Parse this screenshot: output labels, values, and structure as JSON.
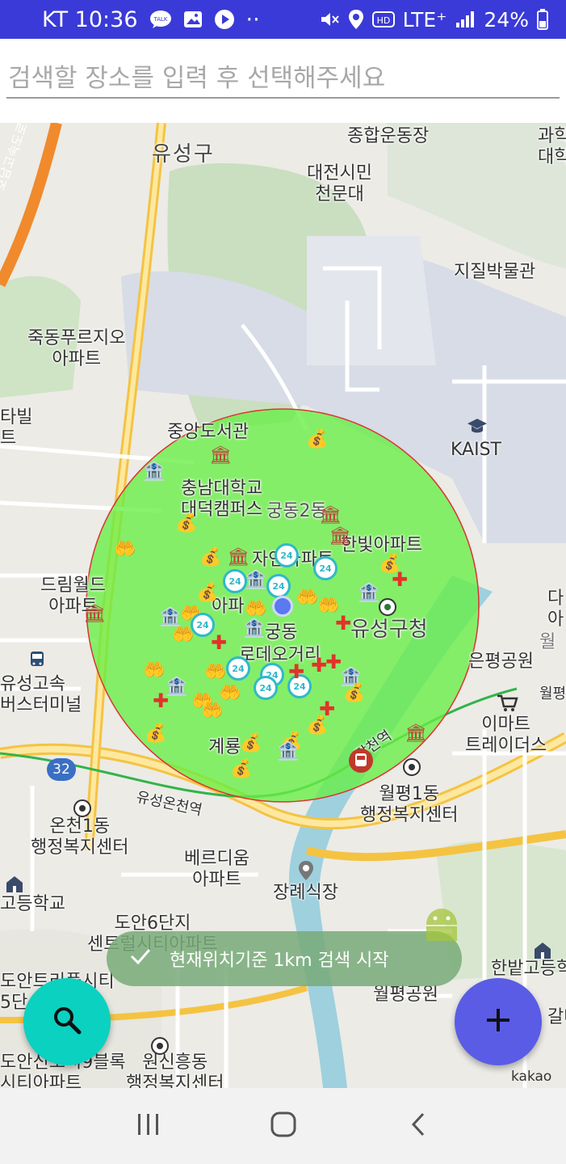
{
  "status_bar": {
    "carrier_time": "KT 10:36",
    "dots": "··",
    "network": "LTE⁺",
    "battery": "24%",
    "icons": [
      "talk-icon",
      "gallery-icon",
      "play-icon",
      "mute-icon",
      "location-icon",
      "hd-icon",
      "signal-icon",
      "battery-icon"
    ]
  },
  "search": {
    "placeholder": "검색할 장소를 입력 후 선택해주세요",
    "value": ""
  },
  "map": {
    "labels": {
      "yuseong_gu": "유성구",
      "sports_complex": "종합운동장",
      "science": "과학\n대학",
      "observatory": "대전시민\n천문대",
      "geology_museum": "지질박물관",
      "jukdong_apt": "죽동푸르지오\n아파트",
      "building_left": "타빌\n트",
      "central_library": "중앙도서관",
      "kaist": "KAIST",
      "cnu": "충남대학교\n대덕캠퍼스",
      "gung2dong": "궁동2동",
      "hanbit_apt": "한빛아파트",
      "nature_apt": "자연아파트",
      "dream_world": "드림월드\n아파트",
      "apt_mid": "아파",
      "gungdong": "궁동",
      "rodeo": "로데오거리",
      "yuseong_office": "유성구청",
      "da_right": "다\n아",
      "eunpyeong_park": "은평공원",
      "wol": "월",
      "yuseong_terminal": "유성고속\n버스터미널",
      "emart": "이마트\n트레이더스",
      "gyeryong": "계룡",
      "apt_mid2": "아파",
      "road_32": "32",
      "wolpyeong": "월평",
      "guam_station": "갑천역",
      "yuseong_oncheon_stn": "유성온천역",
      "oncheon1dong": "온천1동\n행정복지센터",
      "wolpyeong1dong": "월평1동\n행정복지센터",
      "berdium": "베르디움\n아파트",
      "jangrye": "장례식장",
      "high_school": "고등학교",
      "doan6": "도안6단지\n센트럴시티아파트",
      "doan_left": "도안트리플시티\n5단",
      "hanbat_high": "한밭고등학",
      "gal": "갈마",
      "wolpyeong_park": "월평공원",
      "wolpyeong1dong_faded": "월평1동",
      "doan9": "도안신도시9블록\n시티아파트",
      "wonsinheung": "원신흥동\n행정복지센터",
      "highway": "호남고속도로지선"
    },
    "toast_text": "현재위치기준 1km 검색 시작",
    "attribution": "kakao",
    "radius_circle_color": "#66ee44",
    "radius": "1km"
  },
  "fab": {
    "search_icon": "search-icon",
    "add_icon": "add-icon",
    "search_color": "#0bd1c1",
    "add_color": "#5a5ce6"
  },
  "nav_bar": {
    "icons": [
      "recent-apps-icon",
      "home-icon",
      "back-icon"
    ]
  }
}
